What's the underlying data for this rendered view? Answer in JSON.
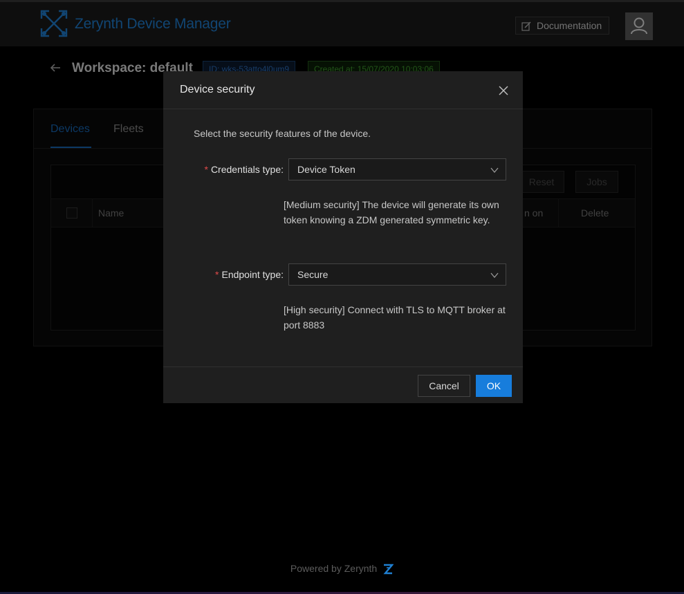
{
  "header": {
    "brand": "Zerynth Device Manager",
    "documentation_label": "Documentation"
  },
  "workspace": {
    "title": "Workspace: default",
    "id_tag": "ID: wks-53atto4l0um9",
    "created_tag": "Created at: 15/07/2020 10:03:06"
  },
  "tabs": [
    {
      "label": "Devices",
      "active": true
    },
    {
      "label": "Fleets",
      "active": false
    }
  ],
  "toolbar": {
    "reset_label": "Reset",
    "jobs_label": "Jobs"
  },
  "table": {
    "columns": [
      "Name",
      "n on",
      "Delete"
    ]
  },
  "modal": {
    "title": "Device security",
    "intro": "Select the security features of the device.",
    "credentials": {
      "label": "Credentials type",
      "value": "Device Token",
      "help": "[Medium security] The device will generate its own token knowing a ZDM generated symmetric key."
    },
    "endpoint": {
      "label": "Endpoint type",
      "value": "Secure",
      "help": "[High security] Connect with TLS to MQTT broker at port 8883"
    },
    "cancel_label": "Cancel",
    "ok_label": "OK"
  },
  "footer": {
    "text": "Powered by Zerynth"
  },
  "colors": {
    "accent": "#177ddc",
    "brand": "#1f7fd1",
    "required": "#e04a4a"
  }
}
